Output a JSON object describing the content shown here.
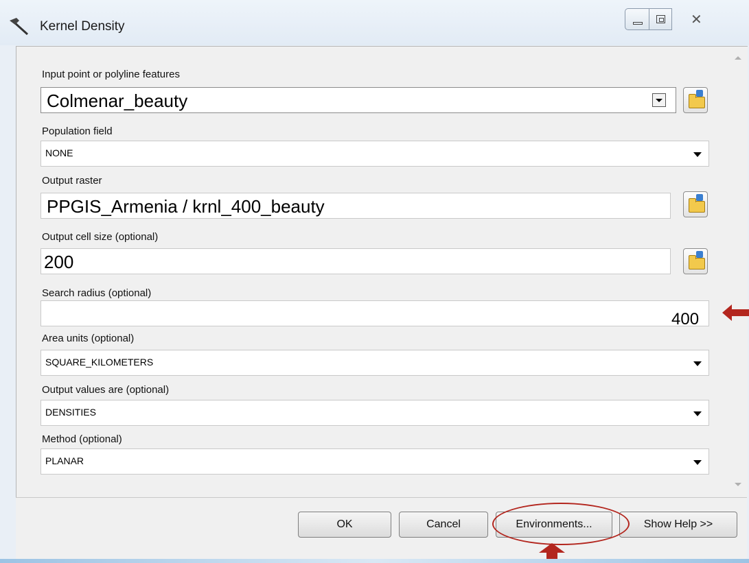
{
  "window": {
    "title": "Kernel Density",
    "title_icon": "hammer-icon",
    "controls": [
      "minimize-icon",
      "maximize-icon",
      "close-icon"
    ]
  },
  "form": {
    "input_features": {
      "label": "Input point or polyline features",
      "value": "Colmenar_beauty"
    },
    "population_field": {
      "label": "Population field",
      "value": "NONE"
    },
    "output_raster": {
      "label": "Output raster",
      "value": "PPGIS_Armenia / krnl_400_beauty"
    },
    "cell_size": {
      "label": "Output cell size (optional)",
      "value": "200"
    },
    "search_radius": {
      "label": "Search radius (optional)",
      "value": "400"
    },
    "area_units": {
      "label": "Area units (optional)",
      "value": "SQUARE_KILOMETERS"
    },
    "output_values": {
      "label": "Output values are (optional)",
      "value": "DENSITIES"
    },
    "method": {
      "label": "Method (optional)",
      "value": "PLANAR"
    }
  },
  "buttons": {
    "ok": "OK",
    "cancel": "Cancel",
    "environments": "Environments...",
    "show_help": "Show Help >>"
  },
  "colors": {
    "annotation_red": "#b3261e",
    "folder_yellow": "#f2c94c"
  }
}
